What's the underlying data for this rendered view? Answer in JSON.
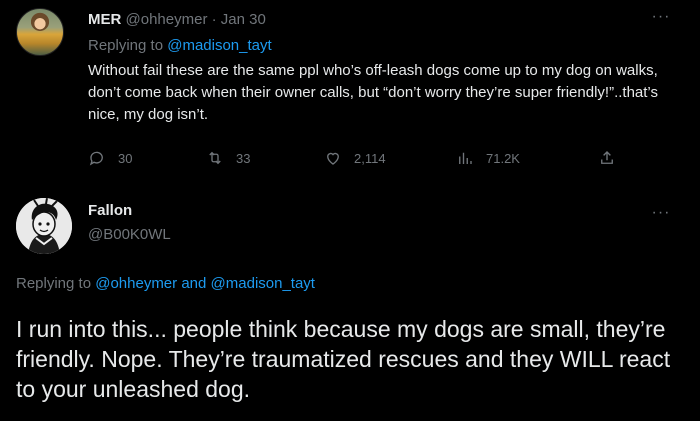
{
  "tweet1": {
    "name": "MER",
    "handle": "@ohheymer",
    "separator": " · ",
    "date": "Jan 30",
    "replying_prefix": "Replying to ",
    "replying_to": "@madison_tayt",
    "body": "Without fail these are the same ppl who’s off-leash dogs come up to my dog on walks, don’t come back when their owner calls, but “don’t worry they’re super friendly!”..that’s nice, my dog isn’t.",
    "actions": {
      "replies": "30",
      "retweets": "33",
      "likes": "2,114",
      "views": "71.2K"
    },
    "more_icon": "more-horizontal-icon"
  },
  "tweet2": {
    "name": "Fallon",
    "handle": "@B00K0WL",
    "replying_prefix": "Replying to ",
    "replying_to_1": "@ohheymer",
    "replying_and": " and ",
    "replying_to_2": "@madison_tayt",
    "body": "I run into this... people think because my dogs are small, they’re friendly. Nope. They’re traumatized rescues and they WILL react to your unleashed dog.",
    "more_icon": "more-horizontal-icon"
  },
  "colors": {
    "background": "#000000",
    "text": "#e7e9ea",
    "muted": "#71767b",
    "link": "#1d9bf0"
  }
}
